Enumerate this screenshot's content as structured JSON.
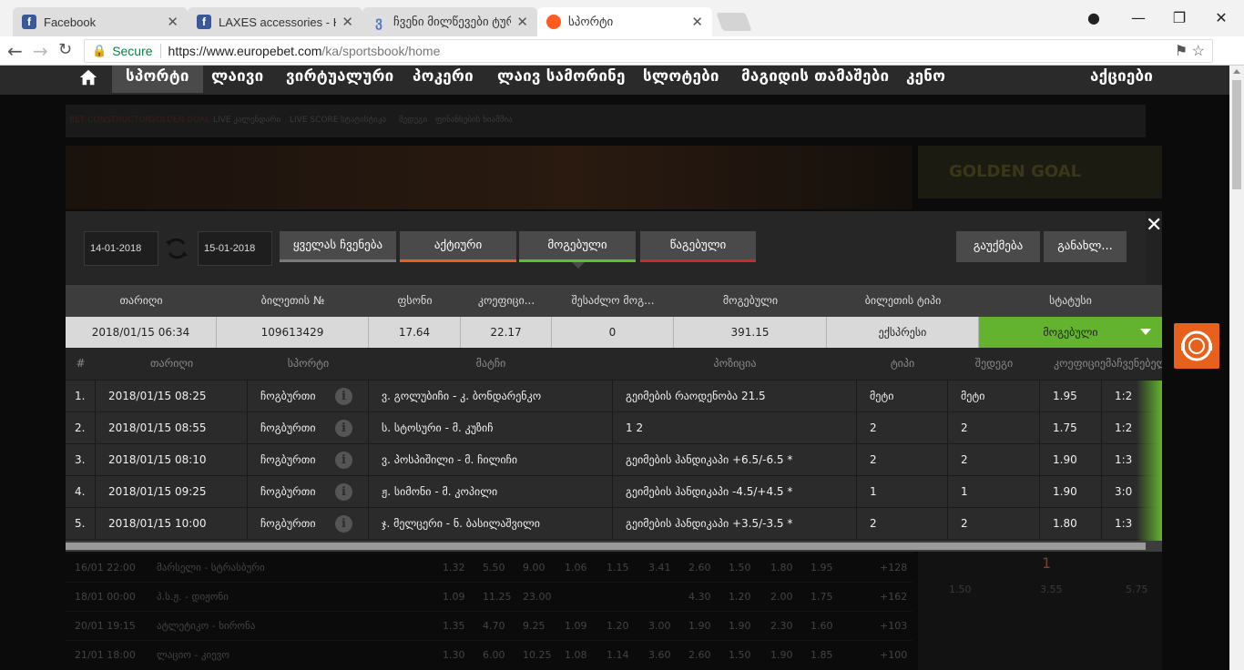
{
  "browser": {
    "tabs": [
      {
        "title": "Facebook",
        "favicon": "facebook-icon"
      },
      {
        "title": "LAXES accessories - Hom",
        "favicon": "facebook-icon"
      },
      {
        "title": "ჩვენი მილწევები ტურ",
        "favicon": "europebet-icon"
      },
      {
        "title": "სპორტი",
        "favicon": "europebet-orange-icon"
      }
    ],
    "secure_label": "Secure",
    "url_host": "https://www.europebet.com",
    "url_path": "/ka/sportsbook/home"
  },
  "nav": {
    "items": [
      "სპორტი",
      "ლაივი",
      "ვირტუალური",
      "პოკერი",
      "ლაივ სამორინე",
      "სლოტები",
      "მაგიდის თამაშები",
      "კენო",
      "აქციები"
    ]
  },
  "background": {
    "subbar": [
      "BET CONSTRUCTOR",
      "GOLDEN GOAL",
      "LIVE კალენდარი",
      "LIVE SCORE",
      "სტატისტიკა",
      "შედეგი",
      "ფინანსების ხიამშია"
    ],
    "golden_goal": "GOLDEN GOAL",
    "rows": [
      {
        "date": "16/01 22:00",
        "match": "მარსელი - სტრასბური",
        "odds": [
          "1.32",
          "5.50",
          "9.00",
          "1.06",
          "1.15",
          "3.41",
          "2.60",
          "1.50",
          "1.80",
          "1.95"
        ],
        "more": "+128"
      },
      {
        "date": "18/01 00:00",
        "match": "პ.ს.ჟ. - დიჟონი",
        "odds": [
          "1.09",
          "11.25",
          "23.00",
          "",
          "",
          "",
          "4.30",
          "1.20",
          "2.00",
          "1.75"
        ],
        "more": "+162"
      },
      {
        "date": "20/01 19:15",
        "match": "ატლეტიკო - ხირონა",
        "odds": [
          "1.35",
          "4.70",
          "9.25",
          "1.09",
          "1.20",
          "3.00",
          "1.90",
          "1.90",
          "2.30",
          "1.60"
        ],
        "more": "+103"
      },
      {
        "date": "21/01 18:00",
        "match": "ლაციო - კიევო",
        "odds": [
          "1.30",
          "6.00",
          "10.25",
          "1.08",
          "1.14",
          "3.60",
          "2.60",
          "1.50",
          "1.90",
          "1.85"
        ],
        "more": "+100"
      }
    ],
    "right_panel": {
      "big_number": "1",
      "odds": [
        "1.50",
        "3.55",
        "5.75"
      ]
    }
  },
  "modal": {
    "date_from": "14-01-2018",
    "date_to": "15-01-2018",
    "filters": {
      "all": "ყველას ჩვენება",
      "active": "აქტიური",
      "won": "მოგებული",
      "lost": "წაგებული"
    },
    "actions": {
      "cancel": "გაუქმება",
      "renew": "განახლ..."
    },
    "summary_headers": [
      "თარიღი",
      "ბილეთის №",
      "ფსონი",
      "კოეფიცი...",
      "შესაძლო მოგ...",
      "მოგებული",
      "ბილეთის ტიპი",
      "სტატუსი"
    ],
    "summary": {
      "date": "2018/01/15 06:34",
      "ticket": "109613429",
      "stake": "17.64",
      "coef": "22.17",
      "possible": "0",
      "won": "391.15",
      "type": "ექსპრესი",
      "status": "მოგებული"
    },
    "detail_headers": [
      "#",
      "თარიღი",
      "სპორტი",
      "მატჩი",
      "პოზიცია",
      "ტიპი",
      "შედეგი",
      "კოეფიციენტი",
      "მაჩვენებელი"
    ],
    "rows": [
      {
        "n": "1.",
        "date": "2018/01/15 08:25",
        "sport": "ჩოგბურთი",
        "match": "ვ. გოლუბიჩი - კ. ბონდარენკო",
        "position": "გეიმების რაოდენობა 21.5",
        "type": "მეტი",
        "result": "მეტი",
        "coef": "1.95",
        "score": "1:2"
      },
      {
        "n": "2.",
        "date": "2018/01/15 08:55",
        "sport": "ჩოგბურთი",
        "match": "ს. სტოსური - მ. კუზიჩ",
        "position": "1 2",
        "type": "2",
        "result": "2",
        "coef": "1.75",
        "score": "1:2"
      },
      {
        "n": "3.",
        "date": "2018/01/15 08:10",
        "sport": "ჩოგბურთი",
        "match": "ვ. პოსპიშილი - მ. ჩილიჩი",
        "position": "გეიმების ჰანდიკაპი +6.5/-6.5 *",
        "type": "2",
        "result": "2",
        "coef": "1.90",
        "score": "1:3"
      },
      {
        "n": "4.",
        "date": "2018/01/15 09:25",
        "sport": "ჩოგბურთი",
        "match": "ჟ. სიმონი - მ. კოპილი",
        "position": "გეიმების ჰანდიკაპი -4.5/+4.5 *",
        "type": "1",
        "result": "1",
        "coef": "1.90",
        "score": "3:0"
      },
      {
        "n": "5.",
        "date": "2018/01/15 10:00",
        "sport": "ჩოგბურთი",
        "match": "ჯ. მელცერი - ნ. ბასილაშვილი",
        "position": "გეიმების ჰანდიკაპი +3.5/-3.5 *",
        "type": "2",
        "result": "2",
        "coef": "1.80",
        "score": "1:3"
      }
    ]
  },
  "colors": {
    "accent_orange": "#e8611c",
    "won_green": "#63b32e",
    "lost_red": "#cc2a2a"
  }
}
